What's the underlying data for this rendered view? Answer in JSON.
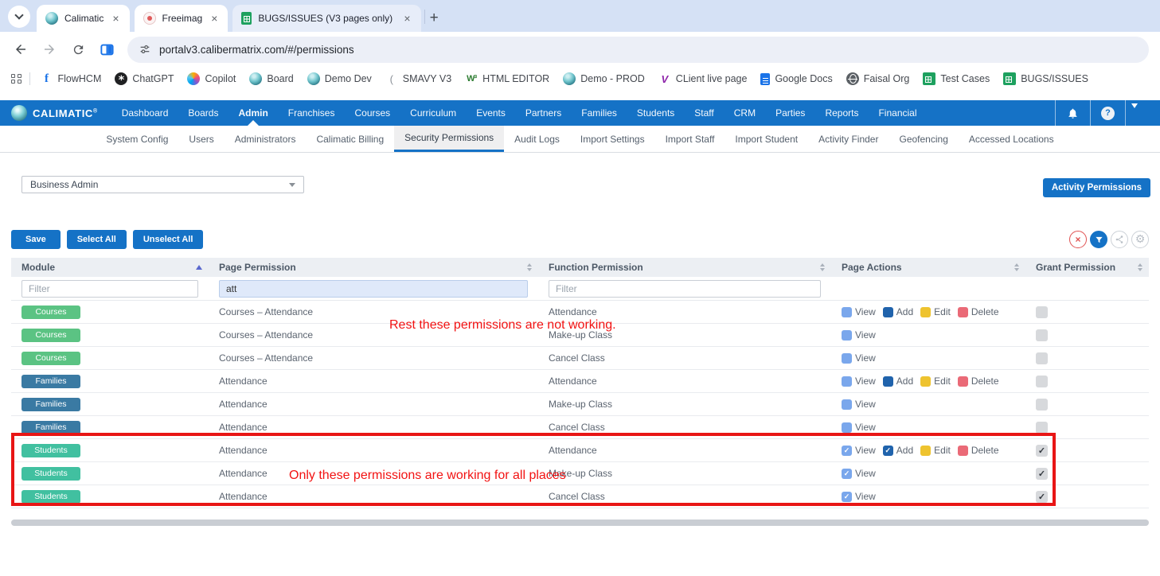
{
  "browser": {
    "tabs": [
      {
        "title": "Calimatic",
        "icon": "calimatic"
      },
      {
        "title": "Freeimag",
        "icon": "freeimage"
      },
      {
        "title": "BUGS/ISSUES (V3 pages only) -",
        "icon": "sheets"
      }
    ],
    "address": {
      "url": "portalv3.calibermatrix.com/#/permissions"
    },
    "bookmarks": [
      {
        "label": "FlowHCM",
        "icon": "flowhcm"
      },
      {
        "label": "ChatGPT",
        "icon": "openai"
      },
      {
        "label": "Copilot",
        "icon": "copilot"
      },
      {
        "label": "Board",
        "icon": "calimatic"
      },
      {
        "label": "Demo Dev",
        "icon": "calimatic"
      },
      {
        "label": "SMAVY V3",
        "icon": "paren"
      },
      {
        "label": "HTML EDITOR",
        "icon": "w3"
      },
      {
        "label": "Demo - PROD",
        "icon": "calimatic"
      },
      {
        "label": "CLient live page",
        "icon": "vlogo"
      },
      {
        "label": "Google Docs",
        "icon": "docs"
      },
      {
        "label": "Faisal Org",
        "icon": "globe"
      },
      {
        "label": "Test Cases",
        "icon": "sheets"
      },
      {
        "label": "BUGS/ISSUES",
        "icon": "sheets"
      }
    ]
  },
  "header": {
    "brand": "CALIMATIC",
    "brand_reg": "®",
    "nav": [
      "Dashboard",
      "Boards",
      "Admin",
      "Franchises",
      "Courses",
      "Curriculum",
      "Events",
      "Partners",
      "Families",
      "Students",
      "Staff",
      "CRM",
      "Parties",
      "Reports",
      "Financial"
    ],
    "active_nav": "Admin"
  },
  "subnav": {
    "items": [
      "System Config",
      "Users",
      "Administrators",
      "Calimatic Billing",
      "Security Permissions",
      "Audit Logs",
      "Import Settings",
      "Import Staff",
      "Import Student",
      "Activity Finder",
      "Geofencing",
      "Accessed Locations"
    ],
    "active": "Security Permissions"
  },
  "controls": {
    "role_select_value": "Business Admin",
    "activity_permissions": "Activity Permissions",
    "save": "Save",
    "select_all": "Select All",
    "unselect_all": "Unselect All"
  },
  "table": {
    "columns": [
      "Module",
      "Page Permission",
      "Function Permission",
      "Page Actions",
      "Grant Permission"
    ],
    "sort": {
      "column": "Module",
      "direction": "asc"
    },
    "filters": {
      "module_placeholder": "Filter",
      "page_permission_value": "att",
      "function_placeholder": "Filter"
    },
    "module_colors": {
      "Courses": "#5bc383",
      "Families": "#3a7aa3",
      "Students": "#41c0a0"
    },
    "action_colors": {
      "View": "#7aa7ec",
      "Add": "#2063ac",
      "Edit": "#eec32f",
      "Delete": "#ea6a77"
    },
    "rows": [
      {
        "module": "Courses",
        "page": "Courses – Attendance",
        "function": "Attendance",
        "actions": [
          {
            "name": "View",
            "checked": false
          },
          {
            "name": "Add",
            "checked": false
          },
          {
            "name": "Edit",
            "checked": false
          },
          {
            "name": "Delete",
            "checked": false
          }
        ],
        "granted": false
      },
      {
        "module": "Courses",
        "page": "Courses – Attendance",
        "function": "Make-up Class",
        "actions": [
          {
            "name": "View",
            "checked": false
          }
        ],
        "granted": false
      },
      {
        "module": "Courses",
        "page": "Courses – Attendance",
        "function": "Cancel Class",
        "actions": [
          {
            "name": "View",
            "checked": false
          }
        ],
        "granted": false
      },
      {
        "module": "Families",
        "page": "Attendance",
        "function": "Attendance",
        "actions": [
          {
            "name": "View",
            "checked": false
          },
          {
            "name": "Add",
            "checked": false
          },
          {
            "name": "Edit",
            "checked": false
          },
          {
            "name": "Delete",
            "checked": false
          }
        ],
        "granted": false
      },
      {
        "module": "Families",
        "page": "Attendance",
        "function": "Make-up Class",
        "actions": [
          {
            "name": "View",
            "checked": false
          }
        ],
        "granted": false
      },
      {
        "module": "Families",
        "page": "Attendance",
        "function": "Cancel Class",
        "actions": [
          {
            "name": "View",
            "checked": false
          }
        ],
        "granted": false
      },
      {
        "module": "Students",
        "page": "Attendance",
        "function": "Attendance",
        "actions": [
          {
            "name": "View",
            "checked": true
          },
          {
            "name": "Add",
            "checked": true
          },
          {
            "name": "Edit",
            "checked": false
          },
          {
            "name": "Delete",
            "checked": false
          }
        ],
        "granted": true
      },
      {
        "module": "Students",
        "page": "Attendance",
        "function": "Make-up Class",
        "actions": [
          {
            "name": "View",
            "checked": true
          }
        ],
        "granted": true
      },
      {
        "module": "Students",
        "page": "Attendance",
        "function": "Cancel Class",
        "actions": [
          {
            "name": "View",
            "checked": true
          }
        ],
        "granted": true
      }
    ]
  },
  "annotations": {
    "color": "#f21212",
    "rect_color": "#e81515",
    "note_top": "Rest these permissions are not working.",
    "note_bottom": "Only these permissions are working for all places"
  }
}
